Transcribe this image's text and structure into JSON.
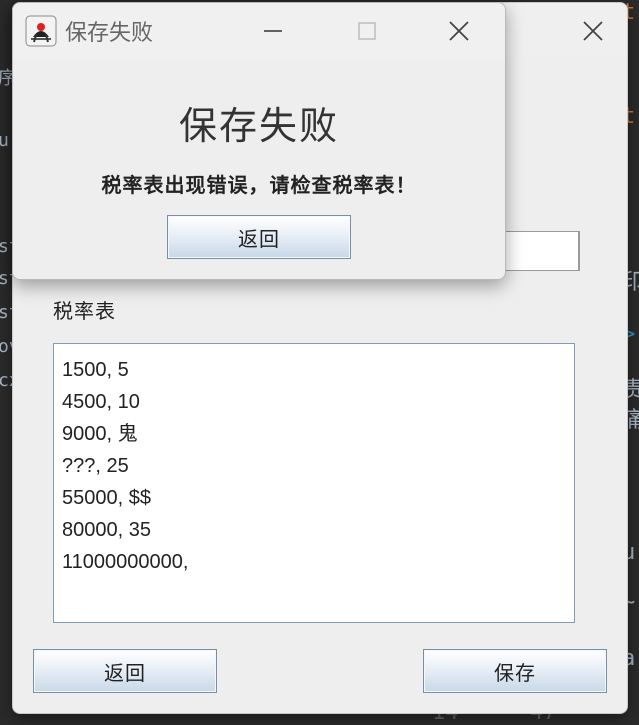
{
  "dialog": {
    "title": "保存失败",
    "heading": "保存失败",
    "message": "税率表出现错误，请检查税率表！",
    "back_button": "返回"
  },
  "main": {
    "tax_table_label": "税率表",
    "tax_table_lines": [
      "1500, 5",
      "4500, 10",
      "9000, 鬼",
      "???, 25",
      "55000, $$",
      "80000, 35",
      "11000000000,"
    ],
    "back_button": "返回",
    "save_button": "保存"
  },
  "background": {
    "left_fragments": [
      "序",
      "u",
      "st",
      "st",
      "st",
      "ov",
      "cx"
    ],
    "right_fragments": [
      "t",
      "t",
      "印",
      ">",
      "责",
      "痛",
      "u",
      "~",
      "a"
    ],
    "bottom_fragments": [
      "14",
      "47"
    ]
  },
  "colors": {
    "window_bg": "#eeeeee",
    "button_gradient_bottom": "#c8d8e8",
    "editor_bg": "#2b2b2b",
    "accent_orange": "#cc7832",
    "accent_blue": "#3592c4"
  }
}
